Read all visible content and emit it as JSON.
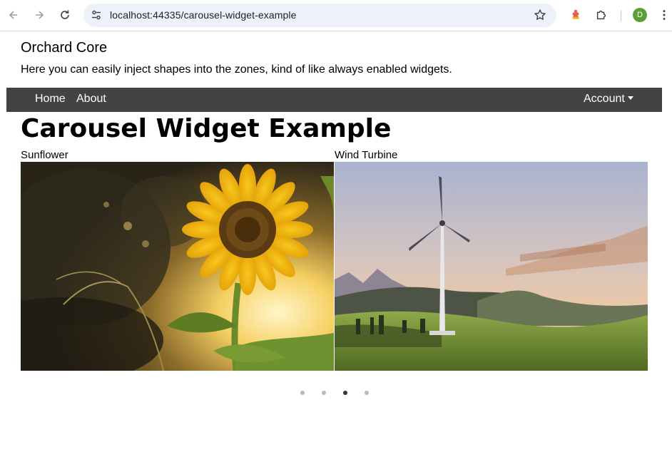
{
  "browser": {
    "url": "localhost:44335/carousel-widget-example",
    "profile_initial": "D",
    "icons": [
      "back-arrow-icon",
      "forward-arrow-icon",
      "reload-icon",
      "site-settings-icon",
      "bookmark-star-icon",
      "extension-icon",
      "puzzle-extensions-icon",
      "more-menu-icon"
    ]
  },
  "site": {
    "title": "Orchard Core",
    "tagline": "Here you can easily inject shapes into the zones, kind of like always enabled widgets."
  },
  "navbar": {
    "items": [
      {
        "label": "Home"
      },
      {
        "label": "About"
      }
    ],
    "account_label": "Account"
  },
  "main": {
    "title": "Carousel Widget Example"
  },
  "carousel": {
    "slides": [
      {
        "caption": "Sunflower"
      },
      {
        "caption": "Wind Turbine"
      }
    ],
    "indicator_count": 4,
    "active_indicator": 2
  },
  "colors": {
    "navbar_bg": "#434343",
    "active_dot": "#333333",
    "inactive_dot": "#b9b9b9"
  }
}
